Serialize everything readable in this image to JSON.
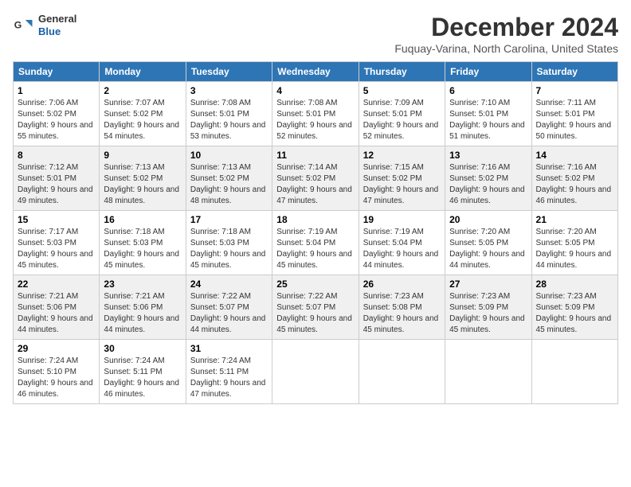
{
  "logo": {
    "general": "General",
    "blue": "Blue"
  },
  "title": "December 2024",
  "location": "Fuquay-Varina, North Carolina, United States",
  "days_of_week": [
    "Sunday",
    "Monday",
    "Tuesday",
    "Wednesday",
    "Thursday",
    "Friday",
    "Saturday"
  ],
  "weeks": [
    [
      {
        "day": "1",
        "sunrise": "Sunrise: 7:06 AM",
        "sunset": "Sunset: 5:02 PM",
        "daylight": "Daylight: 9 hours and 55 minutes."
      },
      {
        "day": "2",
        "sunrise": "Sunrise: 7:07 AM",
        "sunset": "Sunset: 5:02 PM",
        "daylight": "Daylight: 9 hours and 54 minutes."
      },
      {
        "day": "3",
        "sunrise": "Sunrise: 7:08 AM",
        "sunset": "Sunset: 5:01 PM",
        "daylight": "Daylight: 9 hours and 53 minutes."
      },
      {
        "day": "4",
        "sunrise": "Sunrise: 7:08 AM",
        "sunset": "Sunset: 5:01 PM",
        "daylight": "Daylight: 9 hours and 52 minutes."
      },
      {
        "day": "5",
        "sunrise": "Sunrise: 7:09 AM",
        "sunset": "Sunset: 5:01 PM",
        "daylight": "Daylight: 9 hours and 52 minutes."
      },
      {
        "day": "6",
        "sunrise": "Sunrise: 7:10 AM",
        "sunset": "Sunset: 5:01 PM",
        "daylight": "Daylight: 9 hours and 51 minutes."
      },
      {
        "day": "7",
        "sunrise": "Sunrise: 7:11 AM",
        "sunset": "Sunset: 5:01 PM",
        "daylight": "Daylight: 9 hours and 50 minutes."
      }
    ],
    [
      {
        "day": "8",
        "sunrise": "Sunrise: 7:12 AM",
        "sunset": "Sunset: 5:01 PM",
        "daylight": "Daylight: 9 hours and 49 minutes."
      },
      {
        "day": "9",
        "sunrise": "Sunrise: 7:13 AM",
        "sunset": "Sunset: 5:02 PM",
        "daylight": "Daylight: 9 hours and 48 minutes."
      },
      {
        "day": "10",
        "sunrise": "Sunrise: 7:13 AM",
        "sunset": "Sunset: 5:02 PM",
        "daylight": "Daylight: 9 hours and 48 minutes."
      },
      {
        "day": "11",
        "sunrise": "Sunrise: 7:14 AM",
        "sunset": "Sunset: 5:02 PM",
        "daylight": "Daylight: 9 hours and 47 minutes."
      },
      {
        "day": "12",
        "sunrise": "Sunrise: 7:15 AM",
        "sunset": "Sunset: 5:02 PM",
        "daylight": "Daylight: 9 hours and 47 minutes."
      },
      {
        "day": "13",
        "sunrise": "Sunrise: 7:16 AM",
        "sunset": "Sunset: 5:02 PM",
        "daylight": "Daylight: 9 hours and 46 minutes."
      },
      {
        "day": "14",
        "sunrise": "Sunrise: 7:16 AM",
        "sunset": "Sunset: 5:02 PM",
        "daylight": "Daylight: 9 hours and 46 minutes."
      }
    ],
    [
      {
        "day": "15",
        "sunrise": "Sunrise: 7:17 AM",
        "sunset": "Sunset: 5:03 PM",
        "daylight": "Daylight: 9 hours and 45 minutes."
      },
      {
        "day": "16",
        "sunrise": "Sunrise: 7:18 AM",
        "sunset": "Sunset: 5:03 PM",
        "daylight": "Daylight: 9 hours and 45 minutes."
      },
      {
        "day": "17",
        "sunrise": "Sunrise: 7:18 AM",
        "sunset": "Sunset: 5:03 PM",
        "daylight": "Daylight: 9 hours and 45 minutes."
      },
      {
        "day": "18",
        "sunrise": "Sunrise: 7:19 AM",
        "sunset": "Sunset: 5:04 PM",
        "daylight": "Daylight: 9 hours and 45 minutes."
      },
      {
        "day": "19",
        "sunrise": "Sunrise: 7:19 AM",
        "sunset": "Sunset: 5:04 PM",
        "daylight": "Daylight: 9 hours and 44 minutes."
      },
      {
        "day": "20",
        "sunrise": "Sunrise: 7:20 AM",
        "sunset": "Sunset: 5:05 PM",
        "daylight": "Daylight: 9 hours and 44 minutes."
      },
      {
        "day": "21",
        "sunrise": "Sunrise: 7:20 AM",
        "sunset": "Sunset: 5:05 PM",
        "daylight": "Daylight: 9 hours and 44 minutes."
      }
    ],
    [
      {
        "day": "22",
        "sunrise": "Sunrise: 7:21 AM",
        "sunset": "Sunset: 5:06 PM",
        "daylight": "Daylight: 9 hours and 44 minutes."
      },
      {
        "day": "23",
        "sunrise": "Sunrise: 7:21 AM",
        "sunset": "Sunset: 5:06 PM",
        "daylight": "Daylight: 9 hours and 44 minutes."
      },
      {
        "day": "24",
        "sunrise": "Sunrise: 7:22 AM",
        "sunset": "Sunset: 5:07 PM",
        "daylight": "Daylight: 9 hours and 44 minutes."
      },
      {
        "day": "25",
        "sunrise": "Sunrise: 7:22 AM",
        "sunset": "Sunset: 5:07 PM",
        "daylight": "Daylight: 9 hours and 45 minutes."
      },
      {
        "day": "26",
        "sunrise": "Sunrise: 7:23 AM",
        "sunset": "Sunset: 5:08 PM",
        "daylight": "Daylight: 9 hours and 45 minutes."
      },
      {
        "day": "27",
        "sunrise": "Sunrise: 7:23 AM",
        "sunset": "Sunset: 5:09 PM",
        "daylight": "Daylight: 9 hours and 45 minutes."
      },
      {
        "day": "28",
        "sunrise": "Sunrise: 7:23 AM",
        "sunset": "Sunset: 5:09 PM",
        "daylight": "Daylight: 9 hours and 45 minutes."
      }
    ],
    [
      {
        "day": "29",
        "sunrise": "Sunrise: 7:24 AM",
        "sunset": "Sunset: 5:10 PM",
        "daylight": "Daylight: 9 hours and 46 minutes."
      },
      {
        "day": "30",
        "sunrise": "Sunrise: 7:24 AM",
        "sunset": "Sunset: 5:11 PM",
        "daylight": "Daylight: 9 hours and 46 minutes."
      },
      {
        "day": "31",
        "sunrise": "Sunrise: 7:24 AM",
        "sunset": "Sunset: 5:11 PM",
        "daylight": "Daylight: 9 hours and 47 minutes."
      },
      null,
      null,
      null,
      null
    ]
  ]
}
